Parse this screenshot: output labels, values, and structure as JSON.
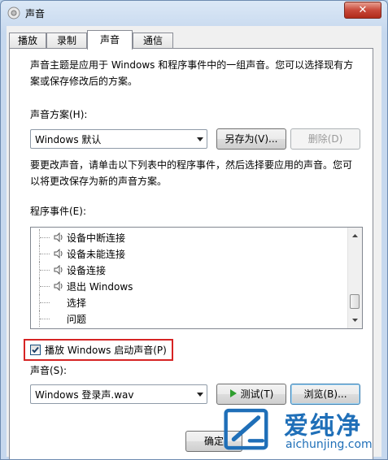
{
  "window": {
    "title": "声音",
    "close_label": "✕"
  },
  "tabs": [
    {
      "label": "播放",
      "active": false
    },
    {
      "label": "录制",
      "active": false
    },
    {
      "label": "声音",
      "active": true
    },
    {
      "label": "通信",
      "active": false
    }
  ],
  "sounds_page": {
    "intro_line1": "声音主题是应用于 Windows 和程序事件中的一组声音。您可以选择现有方",
    "intro_line2": "案或保存修改后的方案。",
    "scheme_label": "声音方案(H):",
    "scheme_value": "Windows 默认",
    "save_as_label": "另存为(V)...",
    "delete_label": "删除(D)",
    "change_line1": "要更改声音，请单击以下列表中的程序事件，然后选择要应用的声音。您可",
    "change_line2": "以将更改保存为新的声音方案。",
    "events_label": "程序事件(E):",
    "events": [
      {
        "label": "设备中断连接",
        "has_sound": true
      },
      {
        "label": "设备未能连接",
        "has_sound": true
      },
      {
        "label": "设备连接",
        "has_sound": true
      },
      {
        "label": "退出 Windows",
        "has_sound": true
      },
      {
        "label": "选择",
        "has_sound": false
      },
      {
        "label": "问题",
        "has_sound": false
      }
    ],
    "startup_checkbox_label": "播放 Windows 启动声音(P)",
    "startup_checked": true,
    "sound_label": "声音(S):",
    "sound_value": "Windows 登录声.wav",
    "test_label": "测试(T)",
    "browse_label": "浏览(B)...",
    "ok_label": "确定"
  },
  "watermark": {
    "brand": "爱纯净",
    "url": "aichunjing.com"
  },
  "colors": {
    "highlight_border": "#d62424",
    "play_green": "#2e9e2e"
  }
}
